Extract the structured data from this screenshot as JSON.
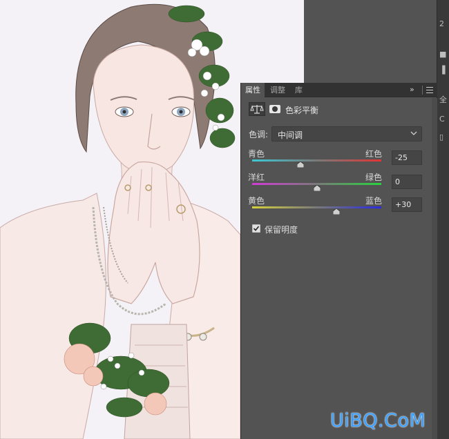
{
  "panel": {
    "tabs": [
      {
        "label": "属性",
        "active": true
      },
      {
        "label": "调整",
        "active": false
      },
      {
        "label": "库",
        "active": false
      }
    ],
    "collapse_glyph": "»",
    "adjustment_title": "色彩平衡",
    "tone": {
      "label": "色调:",
      "value": "中间调"
    },
    "sliders": [
      {
        "left_label": "青色",
        "right_label": "红色",
        "value": -25,
        "display": "-25",
        "min": -100,
        "max": 100,
        "gradient_from": "#3bc9d6",
        "gradient_to": "#e23434"
      },
      {
        "left_label": "洋红",
        "right_label": "绿色",
        "value": 0,
        "display": "0",
        "min": -100,
        "max": 100,
        "gradient_from": "#d23bd6",
        "gradient_to": "#28d23b"
      },
      {
        "left_label": "黄色",
        "right_label": "蓝色",
        "value": 30,
        "display": "+30",
        "min": -100,
        "max": 100,
        "gradient_from": "#d6d23b",
        "gradient_to": "#2a2ae0"
      }
    ],
    "preserve_luminosity": {
      "label": "保留明度",
      "checked": true
    }
  },
  "right_strip": {
    "glyphs": [
      "2",
      "■",
      "▐",
      "全",
      "C",
      "▯"
    ]
  },
  "watermark": "UiBQ.CoM",
  "colors": {
    "panel_bg": "#535353",
    "tab_bar_bg": "#323232",
    "watermark": "#3aa0ff"
  }
}
